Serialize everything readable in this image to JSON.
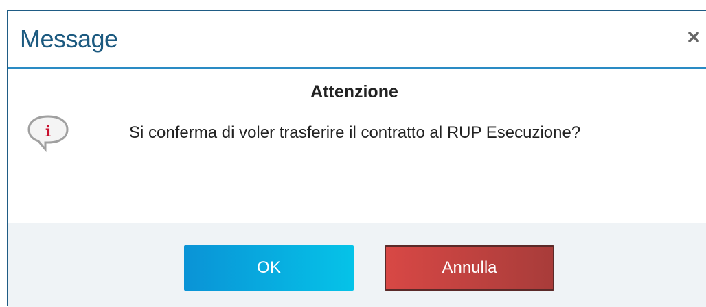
{
  "dialog": {
    "title": "Message",
    "close_icon": "close-icon",
    "heading": "Attenzione",
    "info_icon": "info-speech-bubble-icon",
    "message": "Si conferma di voler trasferire il contratto al RUP Esecuzione?",
    "ok_label": "OK",
    "cancel_label": "Annulla"
  },
  "colors": {
    "title": "#1c5a80",
    "header_border": "#2a8bc4",
    "footer_bg": "#eff3f6",
    "ok_button": "#0aa8e0",
    "cancel_button": "#c8403e"
  }
}
